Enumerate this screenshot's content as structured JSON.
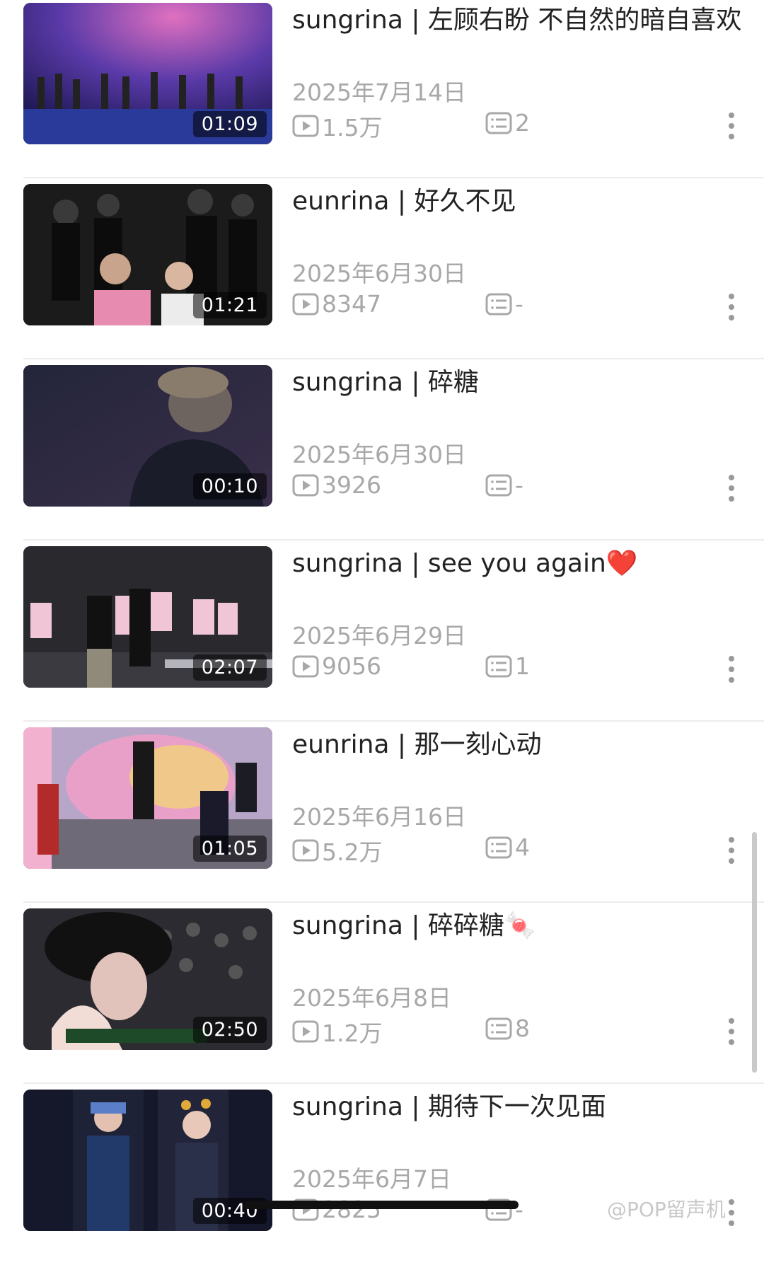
{
  "videos": [
    {
      "title": "sungrina |  左顾右盼 不自然的暗自喜欢",
      "date": "2025年7月14日",
      "duration": "01:09",
      "views": "1.5万",
      "comments": "2"
    },
    {
      "title": "eunrina | 好久不见",
      "date": "2025年6月30日",
      "duration": "01:21",
      "views": "8347",
      "comments": "-"
    },
    {
      "title": "sungrina | 碎糖",
      "date": "2025年6月30日",
      "duration": "00:10",
      "views": "3926",
      "comments": "-"
    },
    {
      "title": "sungrina | see you again❤️",
      "date": "2025年6月29日",
      "duration": "02:07",
      "views": "9056",
      "comments": "1"
    },
    {
      "title": "eunrina | 那一刻心动",
      "date": "2025年6月16日",
      "duration": "01:05",
      "views": "5.2万",
      "comments": "4"
    },
    {
      "title": "sungrina | 碎碎糖🍬",
      "date": "2025年6月8日",
      "duration": "02:50",
      "views": "1.2万",
      "comments": "8"
    },
    {
      "title": "sungrina | 期待下一次见面",
      "date": "2025年6月7日",
      "duration": "00:40",
      "views": "2825",
      "comments": "-"
    }
  ],
  "watermark": "@POP留声机",
  "icons": {
    "views": "play-icon",
    "comments": "comment-icon",
    "more": "more-vertical-icon"
  }
}
